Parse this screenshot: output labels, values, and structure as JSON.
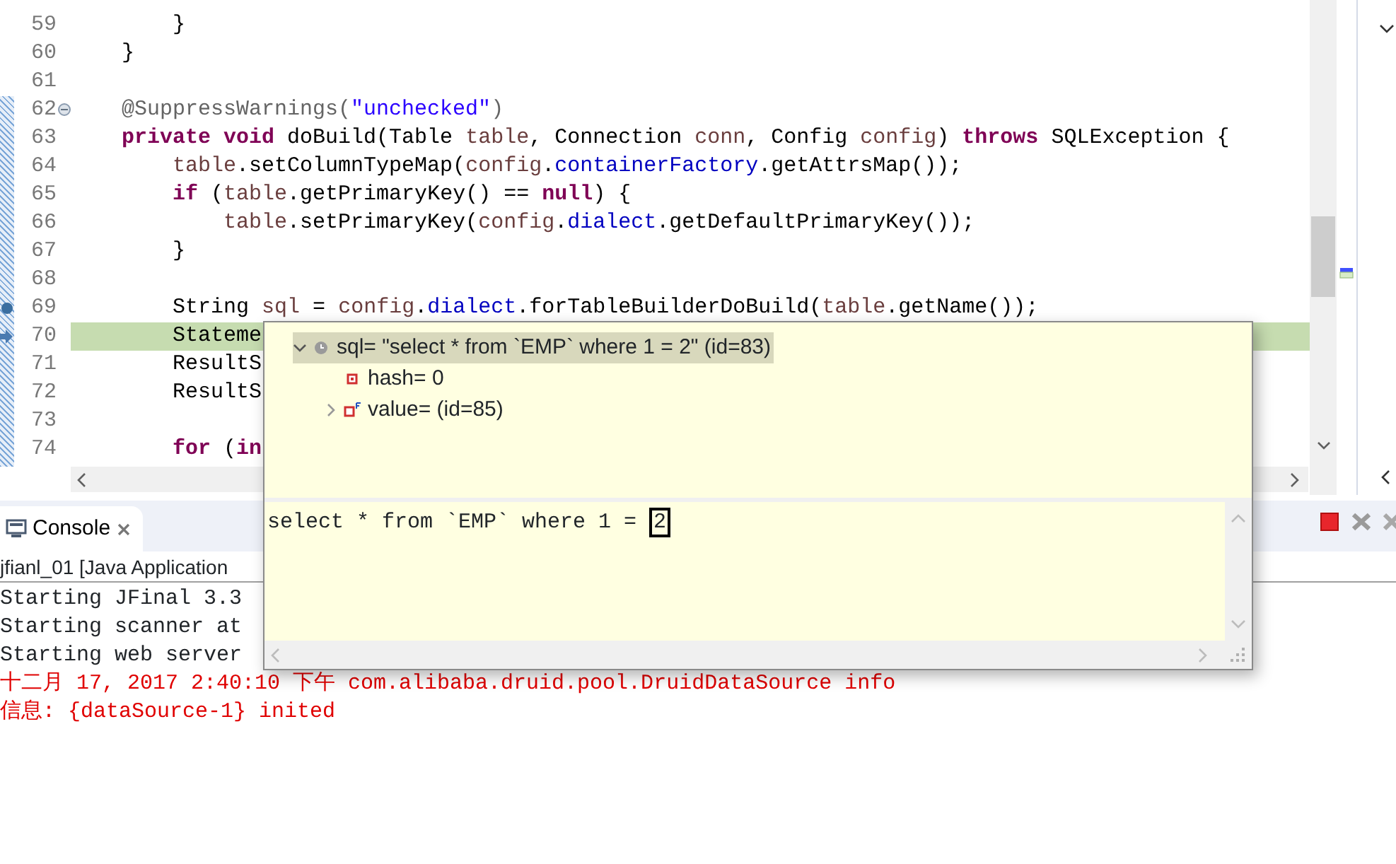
{
  "editor": {
    "lines": [
      {
        "number": "59",
        "tokens": [
          {
            "text": "        }",
            "kind": "plain"
          }
        ]
      },
      {
        "number": "60",
        "tokens": [
          {
            "text": "    }",
            "kind": "plain"
          }
        ]
      },
      {
        "number": "61"
      },
      {
        "number": "62",
        "folded": false,
        "tokens": [
          {
            "text": "    @SuppressWarnings(",
            "kind": "annotation"
          },
          {
            "text": "\"unchecked\"",
            "kind": "string"
          },
          {
            "text": ")",
            "kind": "annotation"
          }
        ]
      },
      {
        "number": "63",
        "tokens": [
          {
            "text": "    private void",
            "kind": "keyword"
          },
          {
            "text": " doBuild(Table ",
            "kind": "plain"
          },
          {
            "text": "table",
            "kind": "local"
          },
          {
            "text": ", Connection ",
            "kind": "plain"
          },
          {
            "text": "conn",
            "kind": "local"
          },
          {
            "text": ", Config ",
            "kind": "plain"
          },
          {
            "text": "config",
            "kind": "local"
          },
          {
            "text": ") ",
            "kind": "plain"
          },
          {
            "text": "throws",
            "kind": "keyword"
          },
          {
            "text": " SQLException {",
            "kind": "plain"
          }
        ]
      },
      {
        "number": "64",
        "tokens": [
          {
            "text": "        table",
            "kind": "local"
          },
          {
            "text": ".setColumnTypeMap(",
            "kind": "plain"
          },
          {
            "text": "config",
            "kind": "local"
          },
          {
            "text": ".",
            "kind": "plain"
          },
          {
            "text": "containerFactory",
            "kind": "field"
          },
          {
            "text": ".getAttrsMap());",
            "kind": "plain"
          }
        ]
      },
      {
        "number": "65",
        "tokens": [
          {
            "text": "        if",
            "kind": "keyword"
          },
          {
            "text": " (",
            "kind": "plain"
          },
          {
            "text": "table",
            "kind": "local"
          },
          {
            "text": ".getPrimaryKey() == ",
            "kind": "plain"
          },
          {
            "text": "null",
            "kind": "keyword"
          },
          {
            "text": ") {",
            "kind": "plain"
          }
        ]
      },
      {
        "number": "66",
        "tokens": [
          {
            "text": "            table",
            "kind": "local"
          },
          {
            "text": ".setPrimaryKey(",
            "kind": "plain"
          },
          {
            "text": "config",
            "kind": "local"
          },
          {
            "text": ".",
            "kind": "plain"
          },
          {
            "text": "dialect",
            "kind": "field"
          },
          {
            "text": ".getDefaultPrimaryKey());",
            "kind": "plain"
          }
        ]
      },
      {
        "number": "67",
        "tokens": [
          {
            "text": "        }",
            "kind": "plain"
          }
        ]
      },
      {
        "number": "68"
      },
      {
        "number": "69",
        "breakpoint": true,
        "tokens": [
          {
            "text": "        String ",
            "kind": "plain"
          },
          {
            "text": "sql",
            "kind": "local"
          },
          {
            "text": " = ",
            "kind": "plain"
          },
          {
            "text": "config",
            "kind": "local"
          },
          {
            "text": ".",
            "kind": "plain"
          },
          {
            "text": "dialect",
            "kind": "field"
          },
          {
            "text": ".forTableBuilderDoBuild(",
            "kind": "plain"
          },
          {
            "text": "table",
            "kind": "local"
          },
          {
            "text": ".getName());",
            "kind": "plain"
          }
        ]
      },
      {
        "number": "70",
        "current": true,
        "tokens": [
          {
            "text": "        Stateme",
            "kind": "plain"
          }
        ]
      },
      {
        "number": "71",
        "tokens": [
          {
            "text": "        ResultS",
            "kind": "plain"
          }
        ]
      },
      {
        "number": "72",
        "tokens": [
          {
            "text": "        ResultS",
            "kind": "plain"
          }
        ]
      },
      {
        "number": "73"
      },
      {
        "number": "74",
        "tokens": [
          {
            "text": "        for",
            "kind": "keyword"
          },
          {
            "text": " (",
            "kind": "plain"
          },
          {
            "text": "in",
            "kind": "keyword"
          }
        ]
      }
    ]
  },
  "console": {
    "tab": {
      "label": "Console"
    },
    "description": "jfianl_01 [Java Application",
    "lines": [
      {
        "text": "Starting JFinal 3.3",
        "kind": "out"
      },
      {
        "text": "Starting scanner at",
        "kind": "out"
      },
      {
        "text": "Starting web server",
        "kind": "out"
      },
      {
        "text": "十二月 17, 2017 2:40:10 下午 com.alibaba.druid.pool.DruidDataSource info",
        "kind": "err"
      },
      {
        "text": "信息: {dataSource-1} inited",
        "kind": "err"
      }
    ]
  },
  "inspector": {
    "variables": [
      {
        "label": "sql= \"select * from `EMP` where 1 = 2\" (id=83)",
        "kind": "local",
        "expanded": true,
        "selected": true,
        "children": [
          {
            "label": "hash= 0",
            "kind": "field",
            "selected": false
          },
          {
            "label": "value= (id=85)",
            "kind": "final-field",
            "expanded": false,
            "selected": false
          }
        ]
      }
    ],
    "detail": {
      "text": "select * from `EMP` where 1 = ",
      "selected_text": "2"
    }
  }
}
